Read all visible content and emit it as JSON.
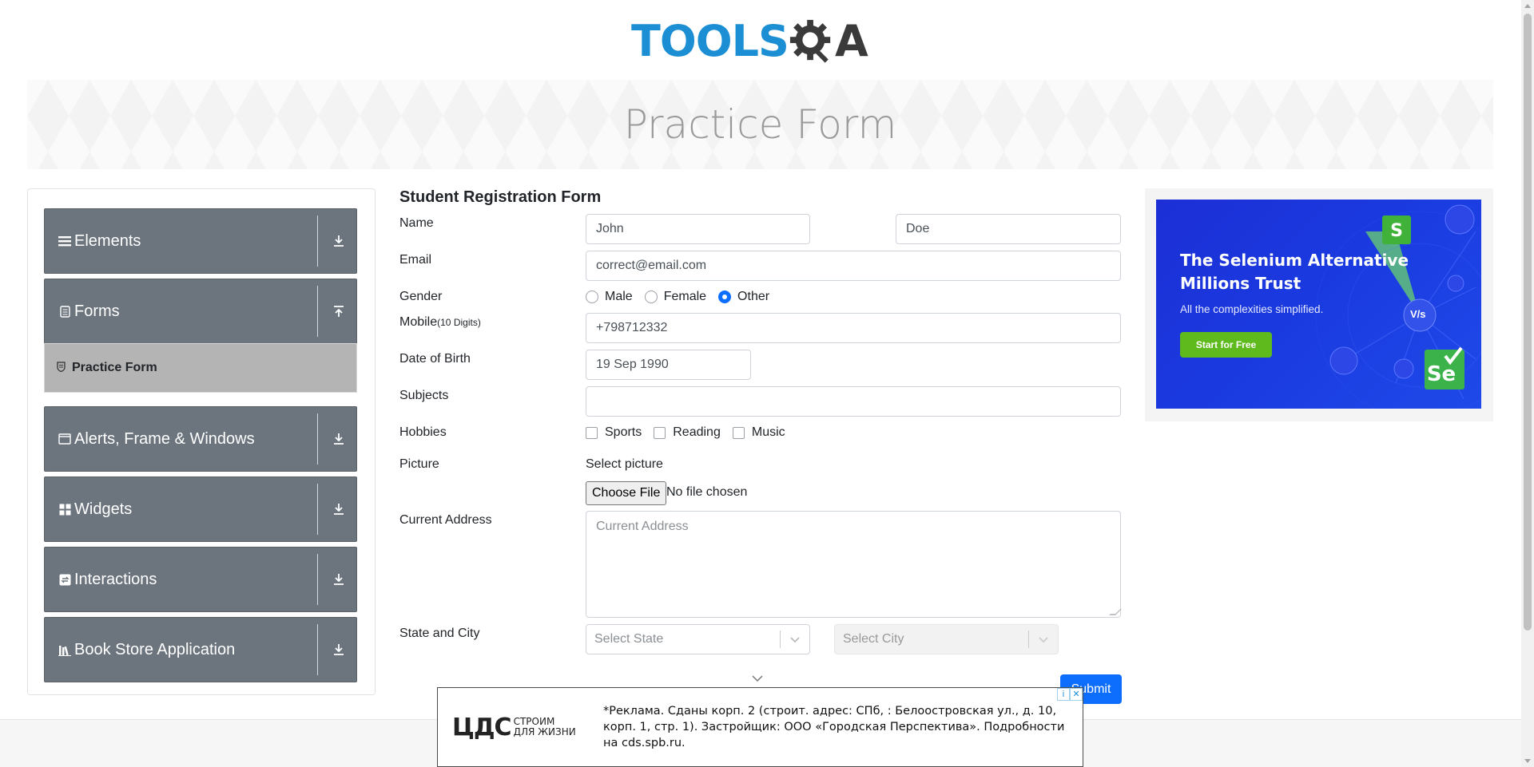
{
  "logo": {
    "part1": "TOOLS",
    "part2": "A",
    "alt": "TOOLSQA"
  },
  "banner": {
    "title": "Practice Form"
  },
  "menu": {
    "groups": [
      {
        "label": "Elements",
        "icon": "hamburger-icon",
        "arrow": "download-icon"
      },
      {
        "label": "Forms",
        "icon": "document-icon",
        "arrow": "upload-icon"
      },
      {
        "label": "Alerts, Frame & Windows",
        "icon": "window-icon",
        "arrow": "download-icon"
      },
      {
        "label": "Widgets",
        "icon": "widgets-icon",
        "arrow": "download-icon"
      },
      {
        "label": "Interactions",
        "icon": "interactions-icon",
        "arrow": "download-icon"
      },
      {
        "label": "Book Store Application",
        "icon": "books-icon",
        "arrow": "download-icon"
      }
    ],
    "active_item": {
      "label": "Practice Form",
      "icon": "shield-icon"
    }
  },
  "form": {
    "title": "Student Registration Form",
    "name_label": "Name",
    "first_name": "John",
    "last_name": "Doe",
    "email_label": "Email",
    "email": "correct@email.com",
    "gender_label": "Gender",
    "gender_options": [
      "Male",
      "Female",
      "Other"
    ],
    "gender_selected": "Other",
    "mobile_label": "Mobile",
    "mobile_hint": "(10 Digits)",
    "mobile": "+798712332",
    "dob_label": "Date of Birth",
    "dob": "19 Sep 1990",
    "subjects_label": "Subjects",
    "hobbies_label": "Hobbies",
    "hobbies": [
      "Sports",
      "Reading",
      "Music"
    ],
    "picture_label": "Picture",
    "picture_prompt": "Select picture",
    "choose_file": "Choose File",
    "file_status": "No file chosen",
    "address_label": "Current Address",
    "address_placeholder": "Current Address",
    "state_city_label": "State and City",
    "state_placeholder": "Select State",
    "city_placeholder": "Select City",
    "submit": "Submit"
  },
  "ad": {
    "title_line1": "The Selenium Alternative",
    "title_line2": "Millions Trust",
    "subtitle": "All the complexities simplified.",
    "button": "Start for Free",
    "badge_vs": "V/s",
    "brand_colors": {
      "bg": "#1c2fd6",
      "button": "#5fbb1d"
    }
  },
  "bottom_ad": {
    "logo": "ЦДС",
    "tagline_line1": "СТРОИМ",
    "tagline_line2": "ДЛЯ ЖИЗНИ",
    "copy": "*Реклама. Сданы корп. 2 (строит. адрес: СПб, : Белоостровская ул., д. 10, корп. 1, стр. 1). Застройщик: ООО «Городская Перспектива». Подробности на cds.spb.ru."
  },
  "colors": {
    "accent": "#0d6efd",
    "menu_bg": "#6c757d",
    "logo_blue": "#1c8fd4"
  }
}
